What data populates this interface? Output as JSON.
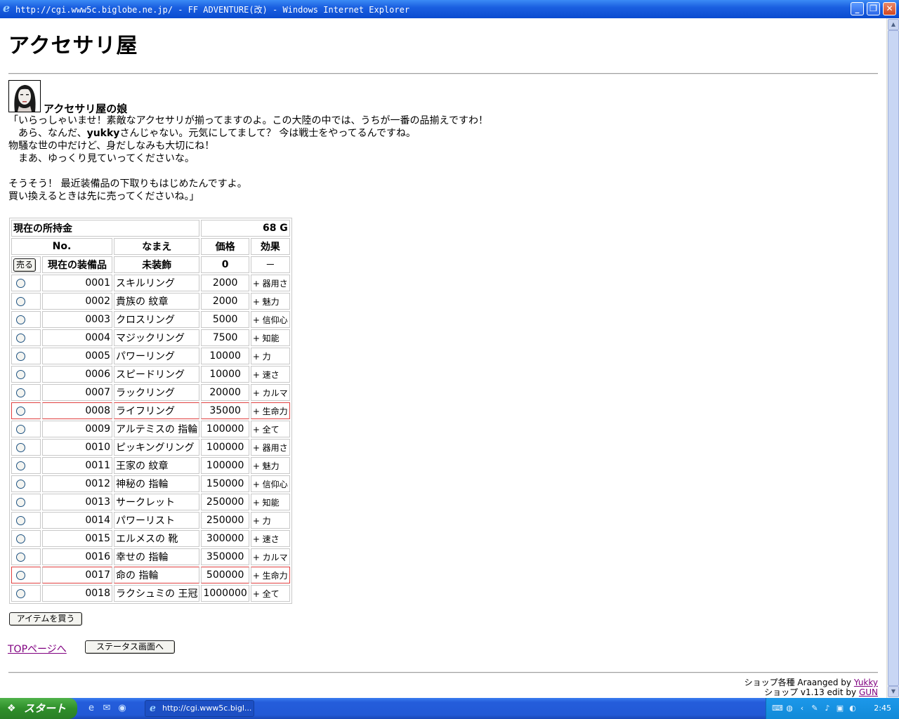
{
  "window": {
    "title": "http://cgi.www5c.biglobe.ne.jp/ - FF ADVENTURE(改) - Windows Internet Explorer",
    "minimize": "_",
    "restore": "❐",
    "close": "✕"
  },
  "page": {
    "heading": "アクセサリ屋",
    "speaker": "アクセサリ屋の娘",
    "dialog": [
      "「いらっしゃいませ！素敵なアクセサリが揃ってますのよ。この大陸の中では、うちが一番の品揃えですわ！",
      "　あら、なんだ、",
      "yukky",
      "さんじゃない。元気にしてまして？ 今は戦士をやってるんですね。",
      "物騒な世の中だけど、身だしなみも大切にね！",
      "　まあ、ゆっくり見ていってくださいな。",
      "",
      "そうそう！ 最近装備品の下取りもはじめたんですよ。",
      "買い換えるときは先に売ってくださいね。」"
    ]
  },
  "shop": {
    "money_label": "現在の所持金",
    "money_value": "68 G",
    "headers": {
      "no": "No.",
      "name": "なまえ",
      "price": "価格",
      "effect": "効果"
    },
    "current": {
      "sell": "売る",
      "label": "現在の装備品",
      "name": "未装飾",
      "price": "0",
      "effect": "－"
    },
    "items": [
      {
        "no": "0001",
        "name": "スキルリング",
        "price": "2000",
        "effect": "+ 器用さ",
        "highlight": false
      },
      {
        "no": "0002",
        "name": "貴族の 紋章",
        "price": "2000",
        "effect": "+ 魅力",
        "highlight": false
      },
      {
        "no": "0003",
        "name": "クロスリング",
        "price": "5000",
        "effect": "+ 信仰心",
        "highlight": false
      },
      {
        "no": "0004",
        "name": "マジックリング",
        "price": "7500",
        "effect": "+ 知能",
        "highlight": false
      },
      {
        "no": "0005",
        "name": "パワーリング",
        "price": "10000",
        "effect": "+ 力",
        "highlight": false
      },
      {
        "no": "0006",
        "name": "スピードリング",
        "price": "10000",
        "effect": "+ 速さ",
        "highlight": false
      },
      {
        "no": "0007",
        "name": "ラックリング",
        "price": "20000",
        "effect": "+ カルマ",
        "highlight": false
      },
      {
        "no": "0008",
        "name": "ライフリング",
        "price": "35000",
        "effect": "+ 生命力",
        "highlight": true
      },
      {
        "no": "0009",
        "name": "アルテミスの 指輪",
        "price": "100000",
        "effect": "+ 全て",
        "highlight": false
      },
      {
        "no": "0010",
        "name": "ピッキングリング",
        "price": "100000",
        "effect": "+ 器用さ",
        "highlight": false
      },
      {
        "no": "0011",
        "name": "王家の 紋章",
        "price": "100000",
        "effect": "+ 魅力",
        "highlight": false
      },
      {
        "no": "0012",
        "name": "神秘の 指輪",
        "price": "150000",
        "effect": "+ 信仰心",
        "highlight": false
      },
      {
        "no": "0013",
        "name": "サークレット",
        "price": "250000",
        "effect": "+ 知能",
        "highlight": false
      },
      {
        "no": "0014",
        "name": "パワーリスト",
        "price": "250000",
        "effect": "+ 力",
        "highlight": false
      },
      {
        "no": "0015",
        "name": "エルメスの 靴",
        "price": "300000",
        "effect": "+ 速さ",
        "highlight": false
      },
      {
        "no": "0016",
        "name": "幸せの 指輪",
        "price": "350000",
        "effect": "+ カルマ",
        "highlight": false
      },
      {
        "no": "0017",
        "name": "命の 指輪",
        "price": "500000",
        "effect": "+ 生命力",
        "highlight": true
      },
      {
        "no": "0018",
        "name": "ラクシュミの 王冠",
        "price": "1000000",
        "effect": "+ 全て",
        "highlight": false
      }
    ],
    "buy_button": "アイテムを買う"
  },
  "nav": {
    "top_link": "TOPページへ",
    "status_button": "ステータス画面へ"
  },
  "credits": {
    "line1_prefix": "ショップ各種 Araanged by ",
    "line1_link": "Yukky",
    "line2_prefix": "ショップ v1.13 edit by ",
    "line2_link": "GUN"
  },
  "taskbar": {
    "start": "スタート",
    "task_label": "http://cgi.www5c.bigl...",
    "clock": "2:45"
  }
}
